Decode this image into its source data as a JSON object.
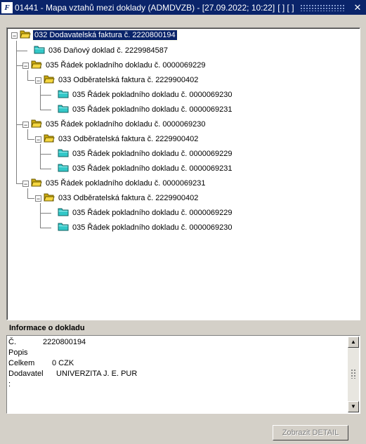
{
  "window": {
    "title": "01441 - Mapa vztahů mezi doklady (ADMDVZB) - [27.09.2022; 10:22]",
    "title_brackets": "[ ] [ ]"
  },
  "tree": {
    "nodes": [
      {
        "label": "032 Dodavatelská faktura č. 2220800194",
        "icon": "folder-open-icon",
        "selected": true
      },
      {
        "label": "036 Daňový doklad č. 2229984587",
        "icon": "folder-closed-icon"
      },
      {
        "label": "035 Řádek pokladního dokladu č. 0000069229",
        "icon": "folder-open-icon"
      },
      {
        "label": "033 Odběratelská faktura č. 2229900402",
        "icon": "folder-open-icon"
      },
      {
        "label": "035 Řádek pokladního dokladu č. 0000069230",
        "icon": "folder-closed-icon"
      },
      {
        "label": "035 Řádek pokladního dokladu č. 0000069231",
        "icon": "folder-closed-icon"
      },
      {
        "label": "035 Řádek pokladního dokladu č. 0000069230",
        "icon": "folder-open-icon"
      },
      {
        "label": "033 Odběratelská faktura č. 2229900402",
        "icon": "folder-open-icon"
      },
      {
        "label": "035 Řádek pokladního dokladu č. 0000069229",
        "icon": "folder-closed-icon"
      },
      {
        "label": "035 Řádek pokladního dokladu č. 0000069231",
        "icon": "folder-closed-icon"
      },
      {
        "label": "035 Řádek pokladního dokladu č. 0000069231",
        "icon": "folder-open-icon"
      },
      {
        "label": "033 Odběratelská faktura č. 2229900402",
        "icon": "folder-open-icon"
      },
      {
        "label": "035 Řádek pokladního dokladu č. 0000069229",
        "icon": "folder-closed-icon"
      },
      {
        "label": "035 Řádek pokladního dokladu č. 0000069230",
        "icon": "folder-closed-icon"
      }
    ]
  },
  "info": {
    "section_title": "Informace o dokladu",
    "cislo_label": "Č. :",
    "cislo_value": "2220800194",
    "popis_label": "Popis :",
    "popis_value": "",
    "celkem_label": "Celkem :",
    "celkem_value": "0 CZK",
    "dodavatel_label": "Dodavatel :",
    "dodavatel_value": "UNIVERZITA J. E. PUR"
  },
  "buttons": {
    "detail_label": "Zobrazit DETAIL"
  },
  "colors": {
    "titlebar": "#0a246a",
    "selection": "#0a246a",
    "folder_open": "#f5d640",
    "folder_closed": "#33c8c8"
  }
}
